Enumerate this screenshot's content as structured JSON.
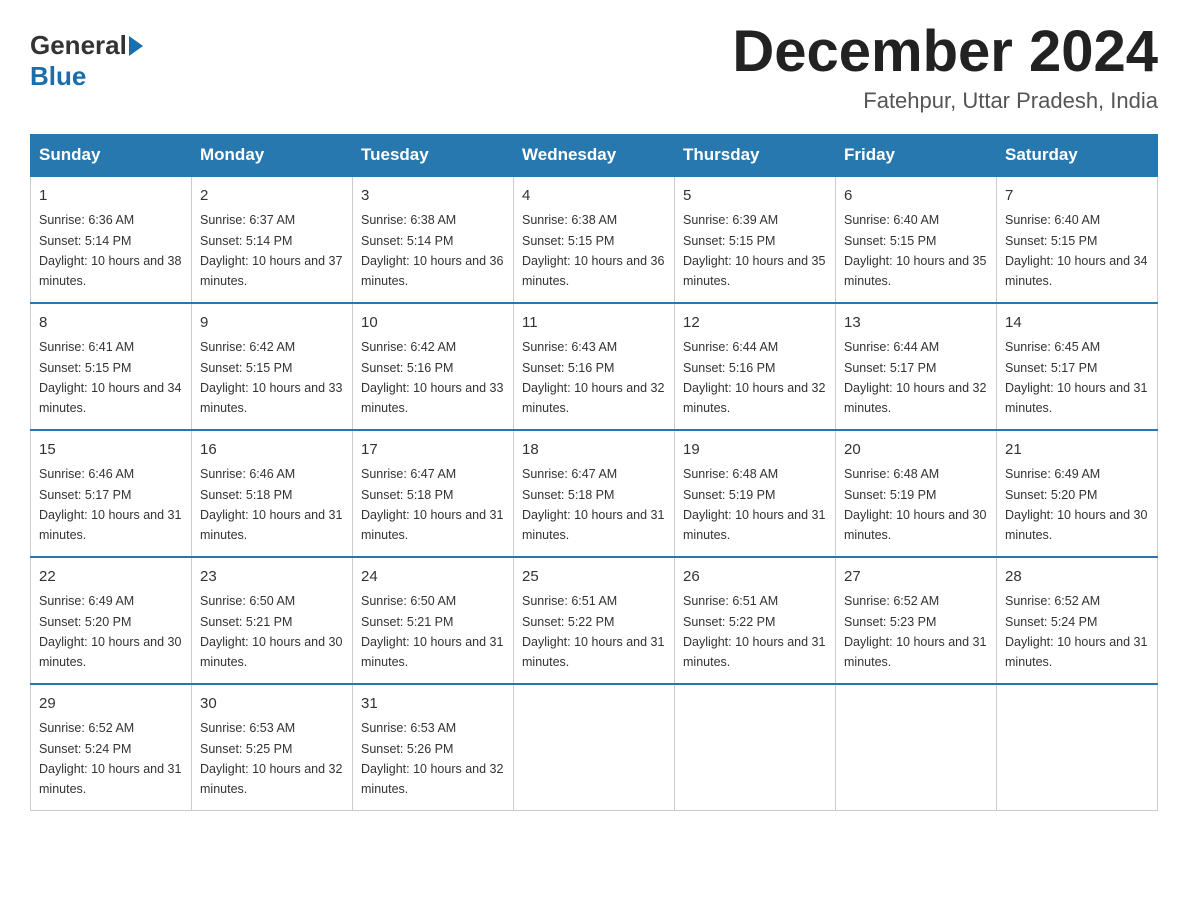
{
  "header": {
    "logo_general": "General",
    "logo_blue": "Blue",
    "month_title": "December 2024",
    "subtitle": "Fatehpur, Uttar Pradesh, India"
  },
  "days_of_week": [
    "Sunday",
    "Monday",
    "Tuesday",
    "Wednesday",
    "Thursday",
    "Friday",
    "Saturday"
  ],
  "weeks": [
    [
      {
        "day": "1",
        "sunrise": "6:36 AM",
        "sunset": "5:14 PM",
        "daylight": "10 hours and 38 minutes."
      },
      {
        "day": "2",
        "sunrise": "6:37 AM",
        "sunset": "5:14 PM",
        "daylight": "10 hours and 37 minutes."
      },
      {
        "day": "3",
        "sunrise": "6:38 AM",
        "sunset": "5:14 PM",
        "daylight": "10 hours and 36 minutes."
      },
      {
        "day": "4",
        "sunrise": "6:38 AM",
        "sunset": "5:15 PM",
        "daylight": "10 hours and 36 minutes."
      },
      {
        "day": "5",
        "sunrise": "6:39 AM",
        "sunset": "5:15 PM",
        "daylight": "10 hours and 35 minutes."
      },
      {
        "day": "6",
        "sunrise": "6:40 AM",
        "sunset": "5:15 PM",
        "daylight": "10 hours and 35 minutes."
      },
      {
        "day": "7",
        "sunrise": "6:40 AM",
        "sunset": "5:15 PM",
        "daylight": "10 hours and 34 minutes."
      }
    ],
    [
      {
        "day": "8",
        "sunrise": "6:41 AM",
        "sunset": "5:15 PM",
        "daylight": "10 hours and 34 minutes."
      },
      {
        "day": "9",
        "sunrise": "6:42 AM",
        "sunset": "5:15 PM",
        "daylight": "10 hours and 33 minutes."
      },
      {
        "day": "10",
        "sunrise": "6:42 AM",
        "sunset": "5:16 PM",
        "daylight": "10 hours and 33 minutes."
      },
      {
        "day": "11",
        "sunrise": "6:43 AM",
        "sunset": "5:16 PM",
        "daylight": "10 hours and 32 minutes."
      },
      {
        "day": "12",
        "sunrise": "6:44 AM",
        "sunset": "5:16 PM",
        "daylight": "10 hours and 32 minutes."
      },
      {
        "day": "13",
        "sunrise": "6:44 AM",
        "sunset": "5:17 PM",
        "daylight": "10 hours and 32 minutes."
      },
      {
        "day": "14",
        "sunrise": "6:45 AM",
        "sunset": "5:17 PM",
        "daylight": "10 hours and 31 minutes."
      }
    ],
    [
      {
        "day": "15",
        "sunrise": "6:46 AM",
        "sunset": "5:17 PM",
        "daylight": "10 hours and 31 minutes."
      },
      {
        "day": "16",
        "sunrise": "6:46 AM",
        "sunset": "5:18 PM",
        "daylight": "10 hours and 31 minutes."
      },
      {
        "day": "17",
        "sunrise": "6:47 AM",
        "sunset": "5:18 PM",
        "daylight": "10 hours and 31 minutes."
      },
      {
        "day": "18",
        "sunrise": "6:47 AM",
        "sunset": "5:18 PM",
        "daylight": "10 hours and 31 minutes."
      },
      {
        "day": "19",
        "sunrise": "6:48 AM",
        "sunset": "5:19 PM",
        "daylight": "10 hours and 31 minutes."
      },
      {
        "day": "20",
        "sunrise": "6:48 AM",
        "sunset": "5:19 PM",
        "daylight": "10 hours and 30 minutes."
      },
      {
        "day": "21",
        "sunrise": "6:49 AM",
        "sunset": "5:20 PM",
        "daylight": "10 hours and 30 minutes."
      }
    ],
    [
      {
        "day": "22",
        "sunrise": "6:49 AM",
        "sunset": "5:20 PM",
        "daylight": "10 hours and 30 minutes."
      },
      {
        "day": "23",
        "sunrise": "6:50 AM",
        "sunset": "5:21 PM",
        "daylight": "10 hours and 30 minutes."
      },
      {
        "day": "24",
        "sunrise": "6:50 AM",
        "sunset": "5:21 PM",
        "daylight": "10 hours and 31 minutes."
      },
      {
        "day": "25",
        "sunrise": "6:51 AM",
        "sunset": "5:22 PM",
        "daylight": "10 hours and 31 minutes."
      },
      {
        "day": "26",
        "sunrise": "6:51 AM",
        "sunset": "5:22 PM",
        "daylight": "10 hours and 31 minutes."
      },
      {
        "day": "27",
        "sunrise": "6:52 AM",
        "sunset": "5:23 PM",
        "daylight": "10 hours and 31 minutes."
      },
      {
        "day": "28",
        "sunrise": "6:52 AM",
        "sunset": "5:24 PM",
        "daylight": "10 hours and 31 minutes."
      }
    ],
    [
      {
        "day": "29",
        "sunrise": "6:52 AM",
        "sunset": "5:24 PM",
        "daylight": "10 hours and 31 minutes."
      },
      {
        "day": "30",
        "sunrise": "6:53 AM",
        "sunset": "5:25 PM",
        "daylight": "10 hours and 32 minutes."
      },
      {
        "day": "31",
        "sunrise": "6:53 AM",
        "sunset": "5:26 PM",
        "daylight": "10 hours and 32 minutes."
      },
      null,
      null,
      null,
      null
    ]
  ]
}
